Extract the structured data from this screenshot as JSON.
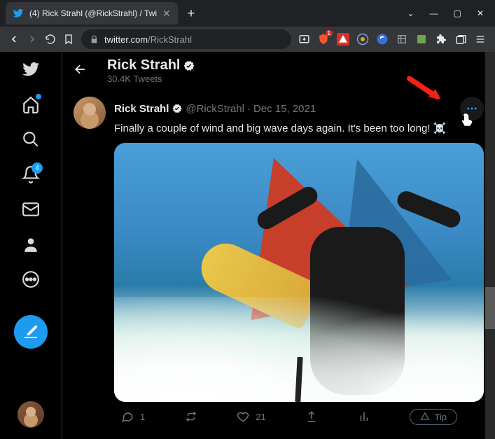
{
  "browser": {
    "tab_title": "(4) Rick Strahl (@RickStrahl) / Twi",
    "url_prefix": "twitter.com",
    "url_path": "/RickStrahl",
    "brave_count": "1"
  },
  "nav": {
    "notifications_count": "4"
  },
  "header": {
    "name": "Rick Strahl",
    "tweets": "30.4K Tweets"
  },
  "tweet": {
    "name": "Rick Strahl",
    "handle": "@RickStrahl",
    "date": "Dec 15, 2021",
    "text": "Finally a couple of wind and big wave days again. It's been too long! ☠️",
    "replies": "1",
    "likes": "21",
    "tip_label": "Tip"
  }
}
